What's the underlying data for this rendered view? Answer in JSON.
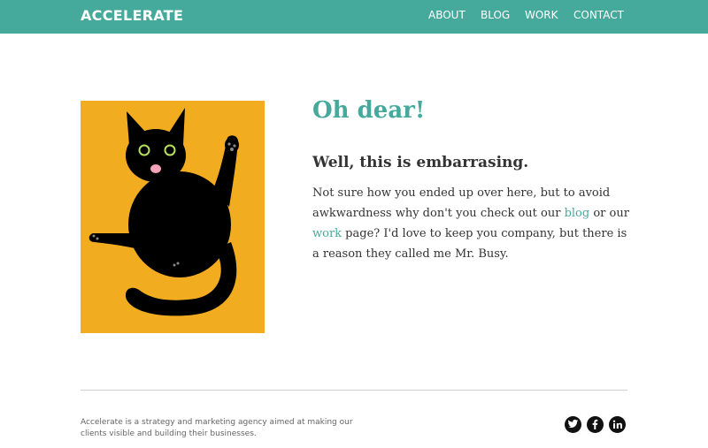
{
  "header": {
    "logo": "ACCELERATE",
    "nav": [
      "ABOUT",
      "BLOG",
      "WORK",
      "CONTACT"
    ]
  },
  "main": {
    "image_alt": "black cat illustration",
    "title": "Oh dear!",
    "subtitle": "Well, this is embarrasing.",
    "paragraph": {
      "part1": "Not sure how you ended up over here, but to avoid awkwardness why don't you check out our ",
      "link1": "blog",
      "part2": " or our ",
      "link2": "work",
      "part3": " page? I'd love to keep you company, but there is a reason they called me Mr. Busy."
    }
  },
  "footer": {
    "text": "Accelerate is a strategy and marketing agency aimed at making our clients visible and building their businesses.",
    "social": [
      "twitter-icon",
      "facebook-icon",
      "linkedin-icon"
    ]
  },
  "colors": {
    "accent": "#45aa9c",
    "cat_background": "#f2ac20",
    "text": "#333333"
  }
}
